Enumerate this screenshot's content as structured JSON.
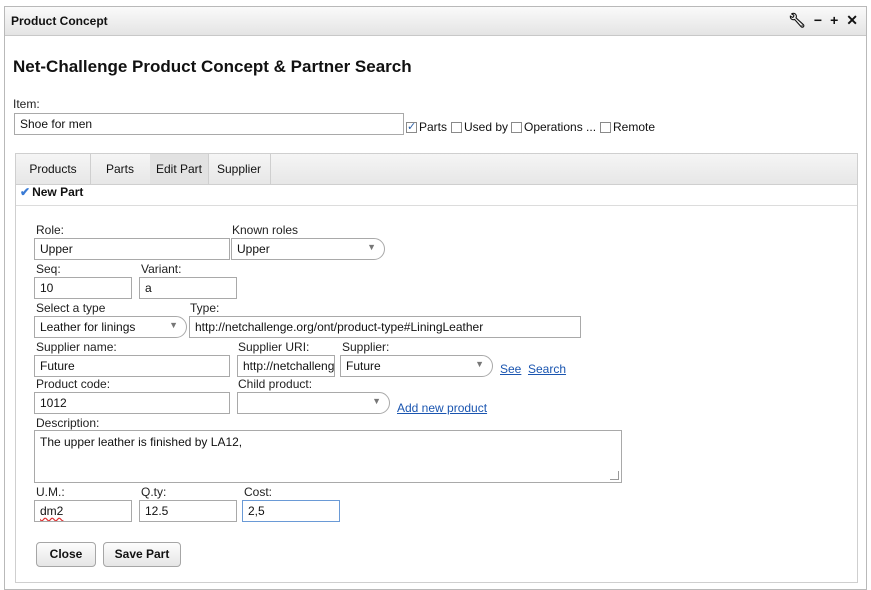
{
  "window": {
    "title": "Product Concept"
  },
  "heading": "Net-Challenge Product Concept & Partner Search",
  "item": {
    "label": "Item:",
    "value": "Shoe for men",
    "checks": [
      {
        "label": "Parts",
        "checked": true
      },
      {
        "label": "Used by",
        "checked": false
      },
      {
        "label": "Operations ...",
        "checked": false
      },
      {
        "label": "Remote",
        "checked": false
      }
    ]
  },
  "tabs": [
    "Products",
    "Parts",
    "Edit Part",
    "Supplier"
  ],
  "active_tab": "Edit Part",
  "section": "New Part",
  "form": {
    "role_label": "Role:",
    "role_value": "Upper",
    "known_roles_label": "Known roles",
    "known_roles_value": "Upper",
    "seq_label": "Seq:",
    "seq_value": "10",
    "variant_label": "Variant:",
    "variant_value": "a",
    "select_type_label": "Select a type",
    "select_type_value": "Leather for linings",
    "type_label": "Type:",
    "type_value": "http://netchallenge.org/ont/product-type#LiningLeather",
    "supplier_name_label": "Supplier name:",
    "supplier_name_value": "Future",
    "supplier_uri_label": "Supplier URI:",
    "supplier_uri_value": "http://netchallenge",
    "supplier_label": "Supplier:",
    "supplier_value": "Future",
    "see_link": "See",
    "search_link": "Search",
    "product_code_label": "Product code:",
    "product_code_value": "1012",
    "child_product_label": "Child product:",
    "child_product_value": "",
    "add_new_product_link": "Add new product",
    "description_label": "Description:",
    "description_value": "The upper leather is finished by LA12,",
    "um_label": "U.M.:",
    "um_value": "dm2",
    "qty_label": "Q.ty:",
    "qty_value": "12.5",
    "cost_label": "Cost:",
    "cost_value": "2,5"
  },
  "buttons": {
    "close": "Close",
    "save": "Save Part"
  }
}
